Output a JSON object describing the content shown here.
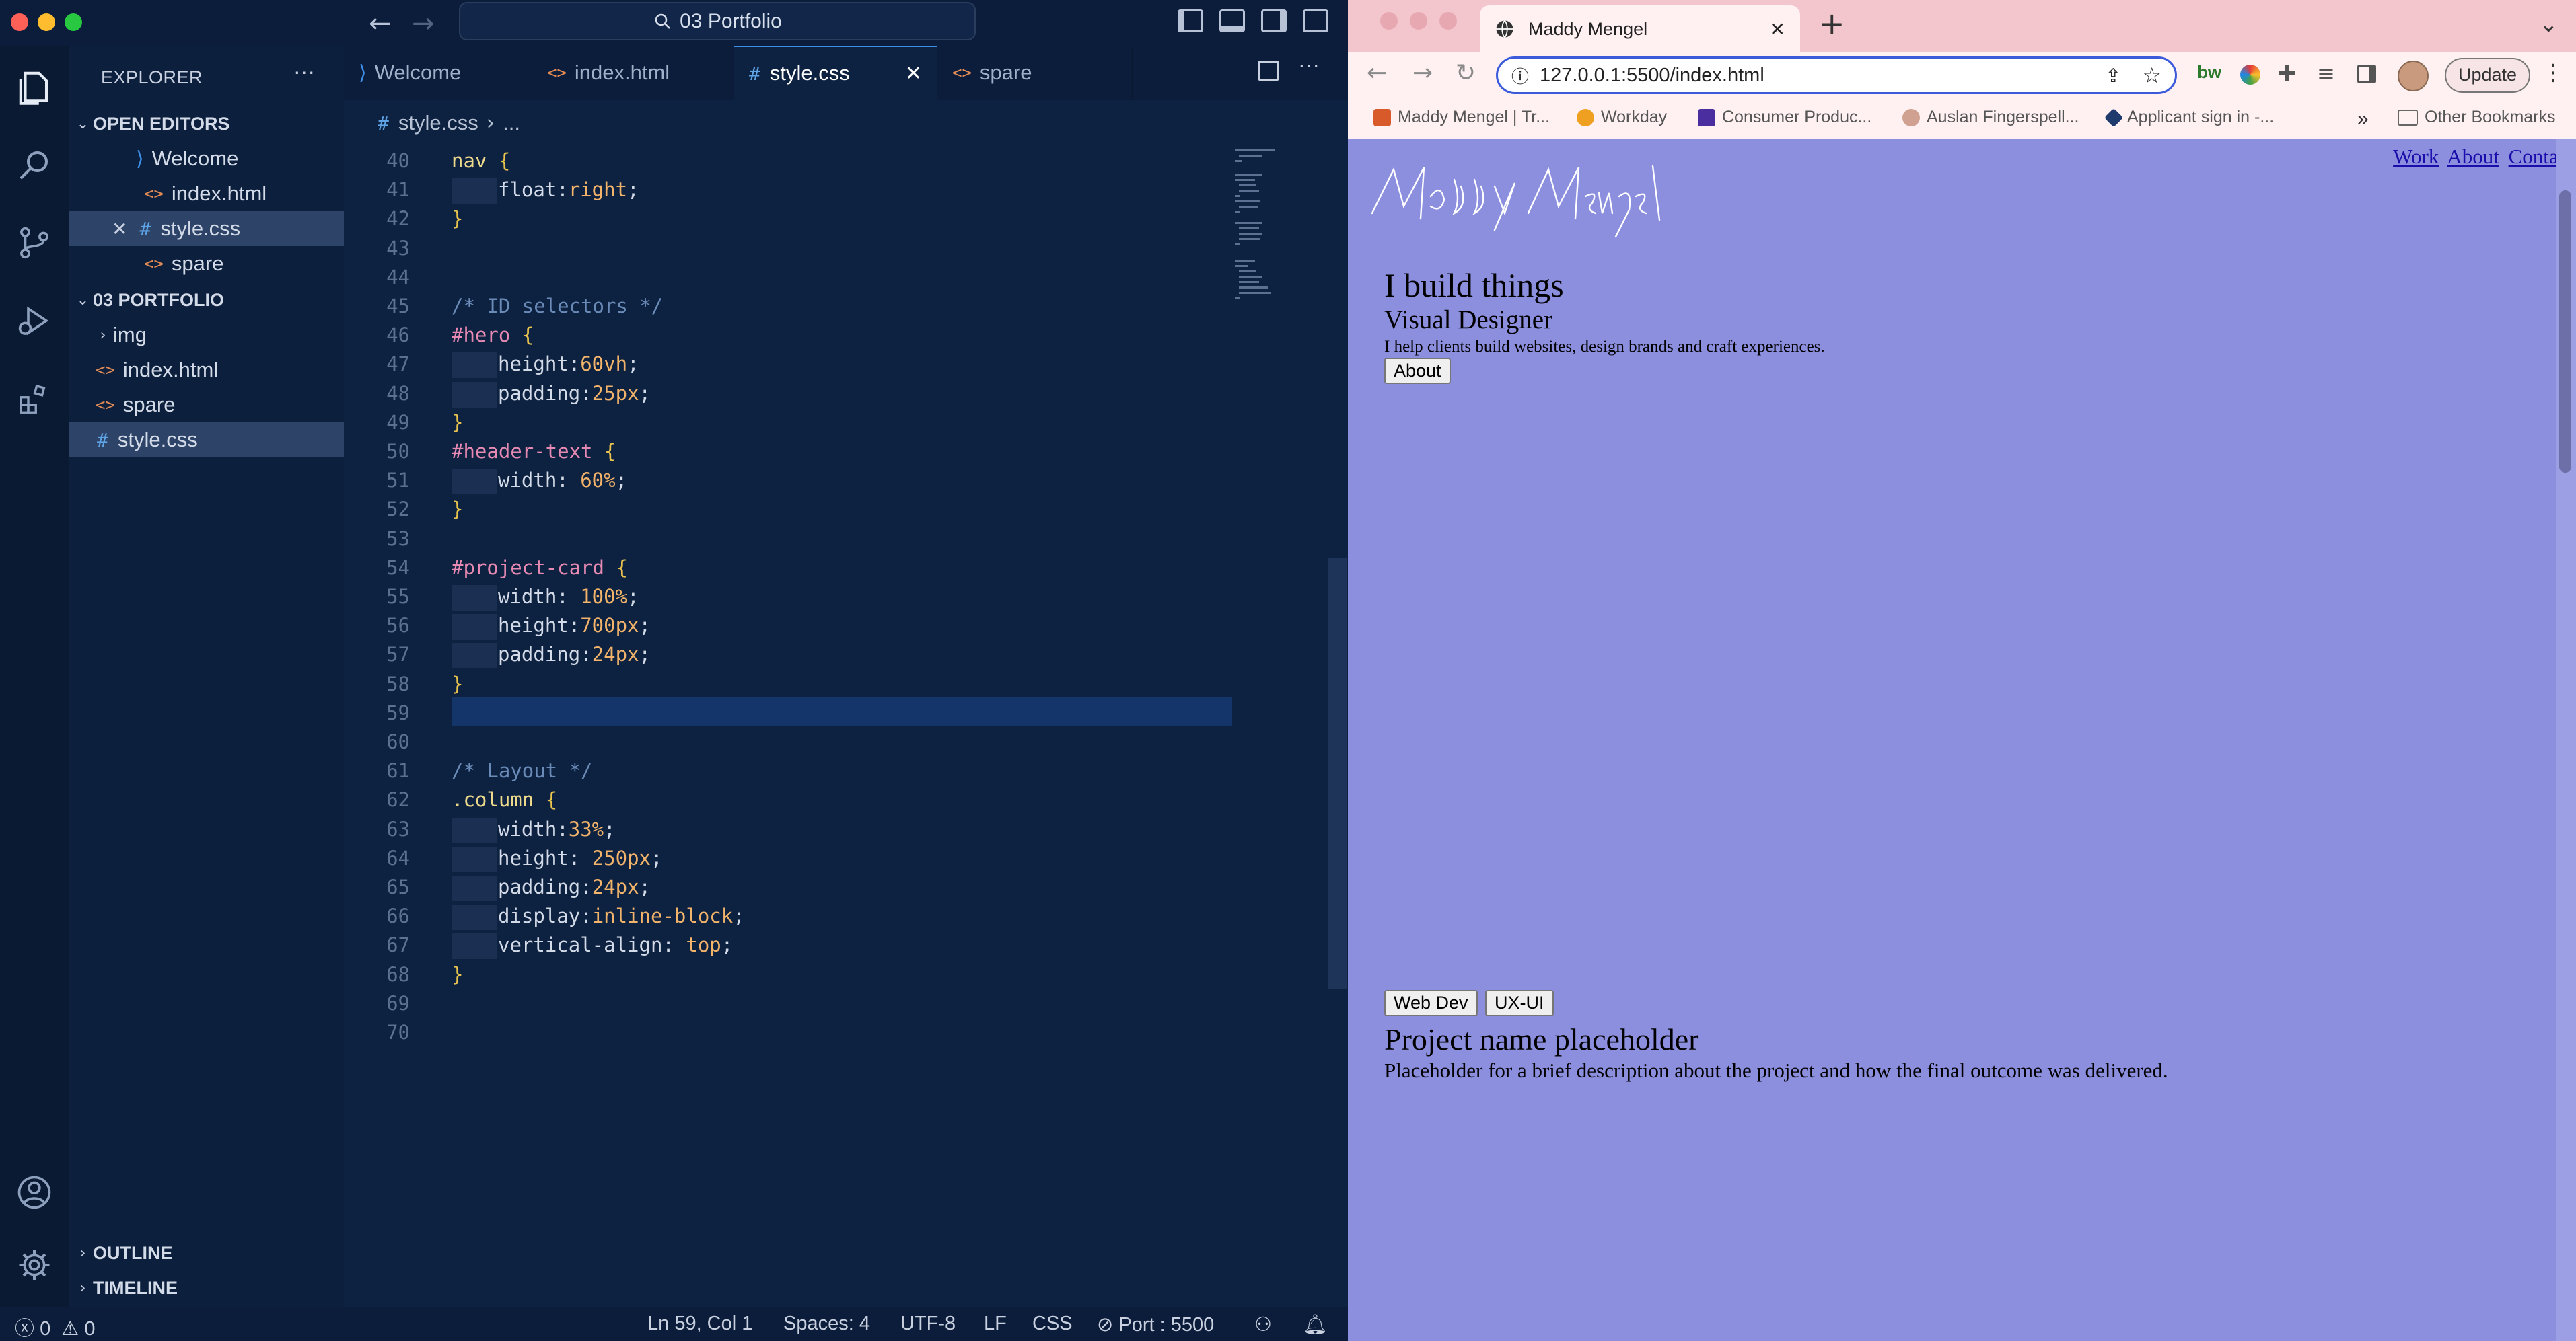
{
  "vscode": {
    "title": "03 Portfolio",
    "explorer_label": "EXPLORER",
    "open_editors_label": "OPEN EDITORS",
    "open_editors": [
      "Welcome",
      "index.html",
      "style.css",
      "spare"
    ],
    "project_label": "03 PORTFOLIO",
    "project_items": [
      "img",
      "index.html",
      "spare",
      "style.css"
    ],
    "outline_label": "OUTLINE",
    "timeline_label": "TIMELINE",
    "tabs": [
      "Welcome",
      "index.html",
      "style.css",
      "spare"
    ],
    "active_tab": "style.css",
    "breadcrumb_file": "style.css",
    "breadcrumb_more": "...",
    "code_lines": [
      {
        "n": "40",
        "parts": [
          {
            "c": "c-sel",
            "t": "nav "
          },
          {
            "c": "c-br",
            "t": "{"
          }
        ]
      },
      {
        "n": "41",
        "ind": 1,
        "parts": [
          {
            "c": "c-prop",
            "t": "float:"
          },
          {
            "c": "c-val",
            "t": "right"
          },
          {
            "c": "c-prop",
            "t": ";"
          }
        ]
      },
      {
        "n": "42",
        "parts": [
          {
            "c": "c-br",
            "t": "}"
          }
        ]
      },
      {
        "n": "43",
        "parts": []
      },
      {
        "n": "44",
        "parts": []
      },
      {
        "n": "45",
        "parts": [
          {
            "c": "c-cmt",
            "t": "/* ID selectors */"
          }
        ]
      },
      {
        "n": "46",
        "parts": [
          {
            "c": "c-id",
            "t": "#hero "
          },
          {
            "c": "c-br",
            "t": "{"
          }
        ]
      },
      {
        "n": "47",
        "ind": 1,
        "parts": [
          {
            "c": "c-prop",
            "t": "height:"
          },
          {
            "c": "c-num",
            "t": "60vh"
          },
          {
            "c": "c-prop",
            "t": ";"
          }
        ]
      },
      {
        "n": "48",
        "ind": 1,
        "parts": [
          {
            "c": "c-prop",
            "t": "padding:"
          },
          {
            "c": "c-num",
            "t": "25px"
          },
          {
            "c": "c-prop",
            "t": ";"
          }
        ]
      },
      {
        "n": "49",
        "parts": [
          {
            "c": "c-br",
            "t": "}"
          }
        ]
      },
      {
        "n": "50",
        "parts": [
          {
            "c": "c-id",
            "t": "#header-text "
          },
          {
            "c": "c-br",
            "t": "{"
          }
        ]
      },
      {
        "n": "51",
        "ind": 1,
        "parts": [
          {
            "c": "c-prop",
            "t": "width: "
          },
          {
            "c": "c-num",
            "t": "60%"
          },
          {
            "c": "c-prop",
            "t": ";"
          }
        ]
      },
      {
        "n": "52",
        "parts": [
          {
            "c": "c-br",
            "t": "}"
          }
        ]
      },
      {
        "n": "53",
        "parts": []
      },
      {
        "n": "54",
        "parts": [
          {
            "c": "c-id",
            "t": "#project-card "
          },
          {
            "c": "c-br",
            "t": "{"
          }
        ]
      },
      {
        "n": "55",
        "ind": 1,
        "parts": [
          {
            "c": "c-prop",
            "t": "width: "
          },
          {
            "c": "c-num",
            "t": "100%"
          },
          {
            "c": "c-prop",
            "t": ";"
          }
        ]
      },
      {
        "n": "56",
        "ind": 1,
        "parts": [
          {
            "c": "c-prop",
            "t": "height:"
          },
          {
            "c": "c-num",
            "t": "700px"
          },
          {
            "c": "c-prop",
            "t": ";"
          }
        ]
      },
      {
        "n": "57",
        "ind": 1,
        "parts": [
          {
            "c": "c-prop",
            "t": "padding:"
          },
          {
            "c": "c-num",
            "t": "24px"
          },
          {
            "c": "c-prop",
            "t": ";"
          }
        ]
      },
      {
        "n": "58",
        "parts": [
          {
            "c": "c-br",
            "t": "}"
          }
        ]
      },
      {
        "n": "59",
        "parts": []
      },
      {
        "n": "60",
        "parts": []
      },
      {
        "n": "61",
        "parts": [
          {
            "c": "c-cmt",
            "t": "/* Layout */"
          }
        ]
      },
      {
        "n": "62",
        "parts": [
          {
            "c": "c-sel",
            "t": ".column "
          },
          {
            "c": "c-br",
            "t": "{"
          }
        ]
      },
      {
        "n": "63",
        "ind": 1,
        "parts": [
          {
            "c": "c-prop",
            "t": "width:"
          },
          {
            "c": "c-num",
            "t": "33%"
          },
          {
            "c": "c-prop",
            "t": ";"
          }
        ]
      },
      {
        "n": "64",
        "ind": 1,
        "parts": [
          {
            "c": "c-prop",
            "t": "height: "
          },
          {
            "c": "c-num",
            "t": "250px"
          },
          {
            "c": "c-prop",
            "t": ";"
          }
        ]
      },
      {
        "n": "65",
        "ind": 1,
        "parts": [
          {
            "c": "c-prop",
            "t": "padding:"
          },
          {
            "c": "c-num",
            "t": "24px"
          },
          {
            "c": "c-prop",
            "t": ";"
          }
        ]
      },
      {
        "n": "66",
        "ind": 1,
        "parts": [
          {
            "c": "c-prop",
            "t": "display:"
          },
          {
            "c": "c-val",
            "t": "inline-block"
          },
          {
            "c": "c-prop",
            "t": ";"
          }
        ]
      },
      {
        "n": "67",
        "ind": 1,
        "parts": [
          {
            "c": "c-prop",
            "t": "vertical-align: "
          },
          {
            "c": "c-val",
            "t": "top"
          },
          {
            "c": "c-prop",
            "t": ";"
          }
        ]
      },
      {
        "n": "68",
        "parts": [
          {
            "c": "c-br",
            "t": "}"
          }
        ]
      },
      {
        "n": "69",
        "parts": []
      },
      {
        "n": "70",
        "parts": []
      }
    ],
    "status": {
      "errors": "0",
      "warnings": "0",
      "position": "Ln 59, Col 1",
      "spaces": "Spaces: 4",
      "encoding": "UTF-8",
      "eol": "LF",
      "language": "CSS",
      "port": "Port : 5500"
    }
  },
  "browser": {
    "tab_title": "Maddy Mengel",
    "url": "127.0.0.1:5500/index.html",
    "update_label": "Update",
    "bookmarks": [
      "Maddy Mengel | Tr...",
      "Workday",
      "Consumer Produc...",
      "Auslan Fingerspell...",
      "Applicant sign in -..."
    ],
    "bookmarks_more": "»",
    "other_bookmarks": "Other Bookmarks",
    "page": {
      "logo": "Maddy Mengel",
      "nav": [
        "Work",
        "About",
        "Contact"
      ],
      "h1": "I build things",
      "h2": "Visual Designer",
      "tagline": "I help clients build websites, design brands and craft experiences.",
      "about_button": "About",
      "tags": [
        "Web Dev",
        "UX-UI"
      ],
      "project_title": "Project name placeholder",
      "project_desc": "Placeholder for a brief description about the project and how the final outcome was delivered."
    },
    "colors": {
      "page_bg": "#8c8fde",
      "tabstrip": "#f3c5cc"
    }
  }
}
